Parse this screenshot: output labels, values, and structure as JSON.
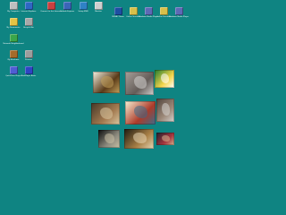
{
  "desktop": {
    "background_color": "#0f8482",
    "icons": [
      {
        "id": "my-computer",
        "label": "My Computer",
        "glyph": "monitor",
        "color": "#bfbfbf"
      },
      {
        "id": "my-documents",
        "label": "My Documents",
        "glyph": "folder",
        "color": "#e5c444"
      },
      {
        "id": "net-hood",
        "label": "Network Neighborhood",
        "glyph": "network",
        "color": "#3aa64a"
      },
      {
        "id": "internet",
        "label": "Internet Explorer",
        "glyph": "globe",
        "color": "#2e67c4"
      },
      {
        "id": "recycle",
        "label": "Recycle Bin",
        "glyph": "bin",
        "color": "#a8a8a8"
      },
      {
        "id": "connect",
        "label": "Connect to the Internet",
        "glyph": "phone",
        "color": "#c84040"
      },
      {
        "id": "outlook",
        "label": "Outlook Express",
        "glyph": "mail",
        "color": "#3b65b8"
      },
      {
        "id": "setup",
        "label": "Setup MSN",
        "glyph": "msn",
        "color": "#2f82c6"
      },
      {
        "id": "briefcase",
        "label": "My Briefcase",
        "glyph": "briefcase",
        "color": "#a56b2a"
      },
      {
        "id": "printers",
        "label": "Printers",
        "glyph": "printer",
        "color": "#9d9d9d"
      },
      {
        "id": "quicktime",
        "label": "QuickTime Player",
        "glyph": "qt",
        "color": "#4f5ed3"
      },
      {
        "id": "realplayer",
        "label": "RealPlayer Basic",
        "glyph": "real",
        "color": "#2e45c3"
      },
      {
        "id": "monitor",
        "label": "Monitor",
        "glyph": "monitor",
        "color": "#cfcfcf"
      },
      {
        "id": "msnbc",
        "label": "MSNBC News",
        "glyph": "news",
        "color": "#1d4fa2"
      },
      {
        "id": "online",
        "label": "Online Services",
        "glyph": "folder",
        "color": "#d8c04a"
      },
      {
        "id": "windows-media",
        "label": "Windows Media Player",
        "glyph": "media",
        "color": "#5d6ab5"
      }
    ],
    "photos": [
      {
        "id": "photo-1",
        "colors": [
          "#f5f3e4",
          "#5a3b19",
          "#c3a15b"
        ]
      },
      {
        "id": "photo-2",
        "colors": [
          "#a9a09a",
          "#645d59",
          "#d4d1cf"
        ]
      },
      {
        "id": "photo-3",
        "colors": [
          "#1f7b2f",
          "#f1d44a",
          "#ffffff"
        ]
      },
      {
        "id": "photo-4",
        "colors": [
          "#443728",
          "#a37a50",
          "#d9c7a0"
        ]
      },
      {
        "id": "photo-5",
        "colors": [
          "#f8f1d5",
          "#ac3b2a",
          "#3d6b8b"
        ]
      },
      {
        "id": "photo-6",
        "colors": [
          "#50433d",
          "#9c8878",
          "#d6d3cf"
        ]
      },
      {
        "id": "photo-7",
        "colors": [
          "#0b0c0c",
          "#8d8a7e",
          "#c8c0a4"
        ]
      },
      {
        "id": "photo-8",
        "colors": [
          "#1c1911",
          "#a87f46",
          "#e5d6b4"
        ]
      },
      {
        "id": "photo-9",
        "colors": [
          "#1d212f",
          "#a4343d",
          "#d4b58f"
        ]
      }
    ]
  }
}
